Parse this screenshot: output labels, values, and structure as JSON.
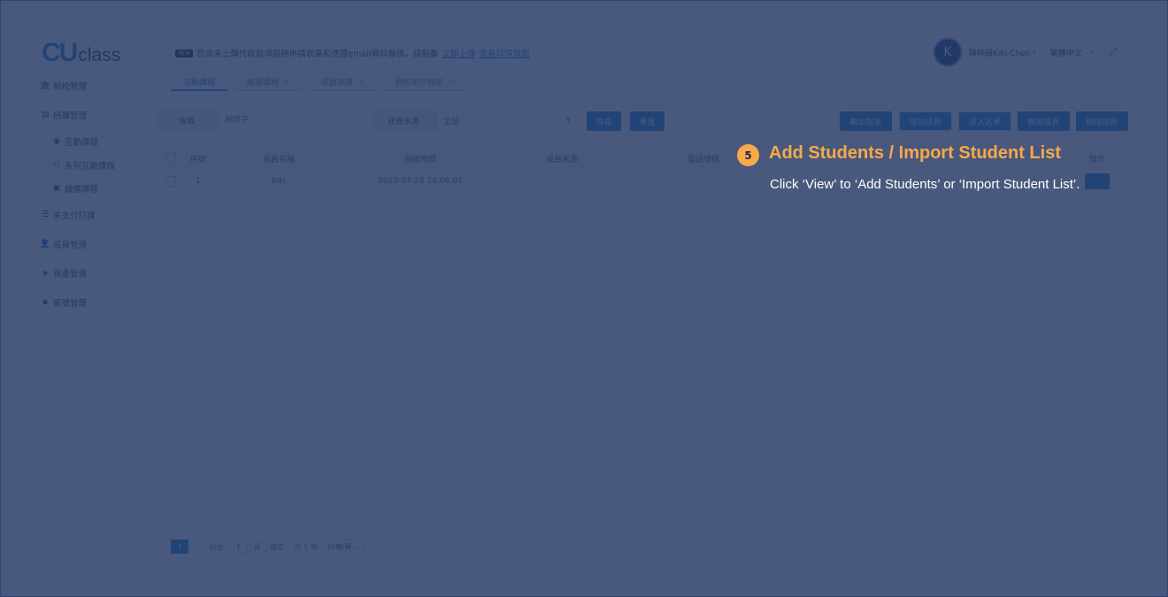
{
  "logo": {
    "mark": "CU",
    "text": "class"
  },
  "notice": {
    "badge": "NEW",
    "text": "您尚未上傳代收款項服務申請表單和憑證email資料審核，請點擊",
    "link1": "立即上傳",
    "link2": "查看詳情頁面"
  },
  "user": {
    "avatar_letter": "K",
    "name": "陳映綺Kiki Chen",
    "language": "繁體中文",
    "fullscreen_icon": "expand-icon"
  },
  "sidebar": {
    "items": [
      {
        "label": "網校管理",
        "icon": "bank-icon"
      },
      {
        "label": "班課管理",
        "icon": "document-icon"
      },
      {
        "label": "互動課程",
        "icon": "eye-icon",
        "sub": true
      },
      {
        "label": "系列互動課程",
        "icon": "users-icon",
        "sub": true
      },
      {
        "label": "線播課程",
        "icon": "film-icon",
        "sub": true
      },
      {
        "label": "未支付訂課",
        "icon": "list-icon"
      },
      {
        "label": "成員管理",
        "icon": "user-icon"
      },
      {
        "label": "資產管理",
        "icon": "diamond-icon"
      },
      {
        "label": "帳號管理",
        "icon": "briefcase-icon"
      }
    ]
  },
  "tabs": [
    {
      "label": "互動課程",
      "active": true,
      "closable": false
    },
    {
      "label": "線播課程",
      "active": false,
      "closable": true
    },
    {
      "label": "成員管理",
      "active": false,
      "closable": true
    },
    {
      "label": "網校用戶數組",
      "active": false,
      "closable": true
    }
  ],
  "filters": {
    "search_label": "搜尋",
    "search_placeholder": "關鍵字",
    "source_label": "成員來源",
    "source_value": "全部",
    "search_button": "搜尋",
    "reset_button": "重置"
  },
  "actions": {
    "export": "輸出報表",
    "add_member": "增加成員",
    "import_list": "匯入名單",
    "copy_member": "複製成員",
    "delete_member": "刪除成員"
  },
  "table": {
    "columns": [
      "序號",
      "成員名稱",
      "創建時間",
      "成員來源",
      "電話號碼",
      "操作"
    ],
    "rows": [
      {
        "index": "1",
        "name": "kiki",
        "created": "2023-07-28 14:06:01",
        "source": "-",
        "phone": ""
      }
    ]
  },
  "pagination": {
    "current_page": "1",
    "goto_label": "前往",
    "goto_value": "1",
    "page_suffix": "頁",
    "confirm": "確定",
    "total": "共 1 條",
    "page_size": "10條/頁"
  },
  "tooltip": {
    "step": "5",
    "title": "Add Students / Import Student List",
    "description": "Click ‘View’ to ‘Add Students’ or ‘Import Student List’.",
    "accent_color": "#f8a94a"
  }
}
